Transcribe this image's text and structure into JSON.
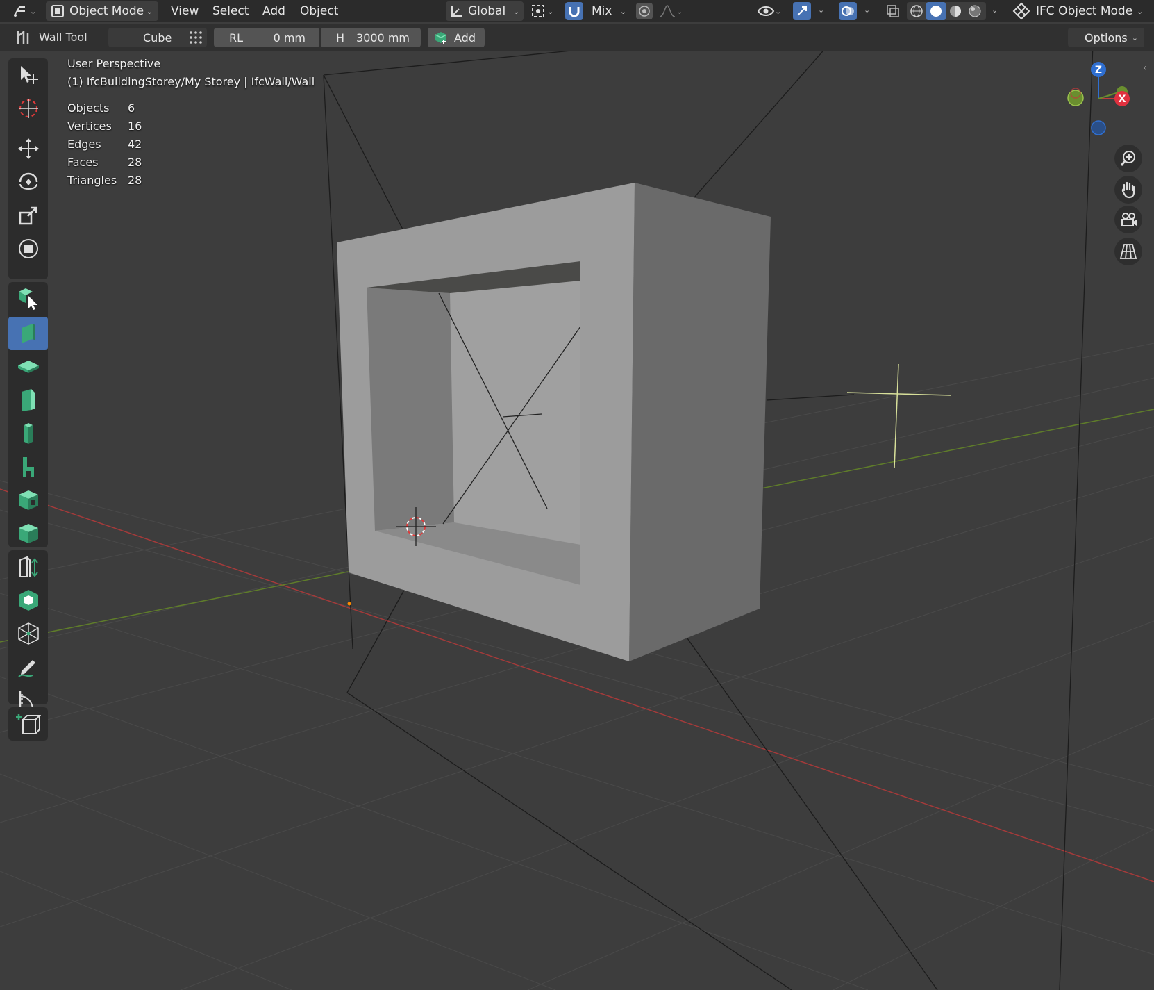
{
  "header": {
    "mode": "Object Mode",
    "menus": [
      "View",
      "Select",
      "Add",
      "Object"
    ],
    "transform_orientation": "Global",
    "snap_target": "Mix",
    "ifc_mode": "IFC Object Mode"
  },
  "tool_settings": {
    "tool_name": "Wall Tool",
    "profile": "Cube",
    "rl_label": "RL",
    "rl_value": "0 mm",
    "h_label": "H",
    "h_value": "3000 mm",
    "add_label": "Add",
    "options_label": "Options"
  },
  "viewport": {
    "view_name": "User Perspective",
    "context": "(1) IfcBuildingStorey/My Storey | IfcWall/Wall",
    "stats": [
      {
        "label": "Objects",
        "value": "6"
      },
      {
        "label": "Vertices",
        "value": "16"
      },
      {
        "label": "Edges",
        "value": "42"
      },
      {
        "label": "Faces",
        "value": "28"
      },
      {
        "label": "Triangles",
        "value": "28"
      }
    ]
  },
  "gizmo": {
    "z": "Z",
    "x": "X"
  },
  "colors": {
    "accent": "#4772b3",
    "ifc_green": "#3aa878",
    "x_axis": "#c03b3b",
    "y_axis": "#6a8f2f",
    "z_axis": "#2f6fd1"
  },
  "toolbar_icons": [
    "select-icon",
    "cursor-icon",
    "move-icon",
    "rotate-icon",
    "scale-icon",
    "transform-icon",
    "ifc-select-icon",
    "wall-tool-icon",
    "slab-tool-icon",
    "door-tool-icon",
    "column-tool-icon",
    "furniture-tool-icon",
    "opening-tool-icon",
    "cube-icon",
    "extrude-icon",
    "ifc-object-icon",
    "mesh-icon",
    "annotate-icon",
    "measure-icon",
    "add-cube-icon"
  ]
}
